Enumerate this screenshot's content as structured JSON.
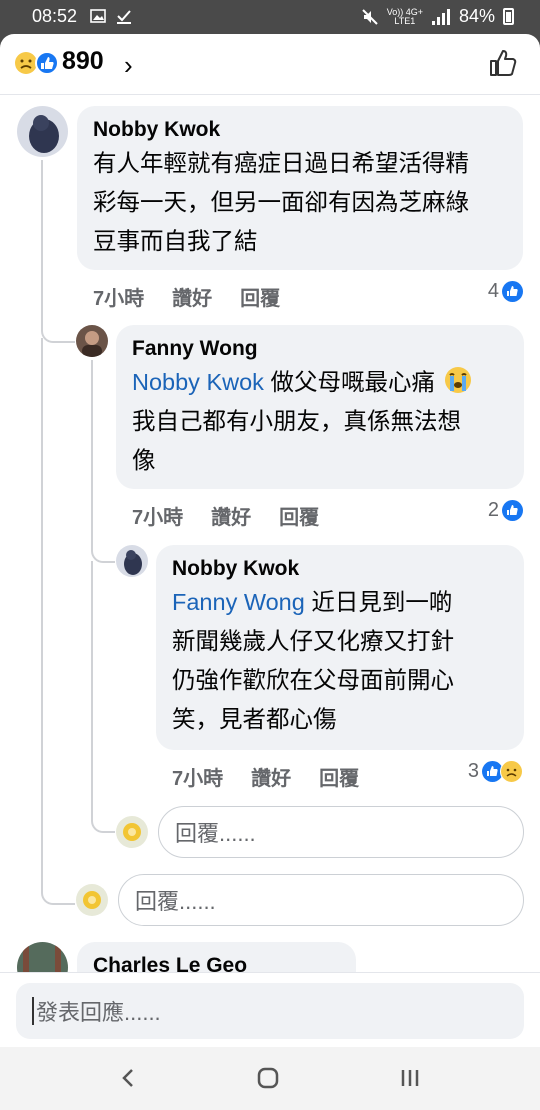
{
  "status_bar": {
    "time": "08:52",
    "network_top": "Vo)) 4G+",
    "network_bottom": "LTE1",
    "battery": "84%"
  },
  "header": {
    "reaction_count": "890"
  },
  "comments": [
    {
      "author": "Nobby Kwok",
      "lines": [
        "有人年輕就有癌症日過日希望活得精",
        "彩每一天，但另一面卻有因為芝麻綠",
        "豆事而自我了結"
      ],
      "time": "7小時",
      "like_label": "讚好",
      "reply_label": "回覆",
      "reactions": "4"
    },
    {
      "author": "Fanny Wong",
      "mention": "Nobby Kwok",
      "first_line_rest": " 做父母嘅最心痛",
      "lines": [
        "我自己都有小朋友，真係無法想",
        "像"
      ],
      "time": "7小時",
      "like_label": "讚好",
      "reply_label": "回覆",
      "reactions": "2"
    },
    {
      "author": "Nobby Kwok",
      "mention": "Fanny Wong",
      "first_line_rest": " 近日見到一啲",
      "lines": [
        "新聞幾歲人仔又化療又打針",
        "仍強作歡欣在父母面前開心",
        "笑，見者都心傷"
      ],
      "time": "7小時",
      "like_label": "讚好",
      "reply_label": "回覆",
      "reactions": "3"
    },
    {
      "author": "Charles Le Geo"
    }
  ],
  "reply_placeholder": "回覆......",
  "composer_placeholder": "發表回應......",
  "colors": {
    "facebook_blue": "#1877f2",
    "mention_blue": "#1b64b8",
    "bubble_bg": "#f0f2f5"
  }
}
